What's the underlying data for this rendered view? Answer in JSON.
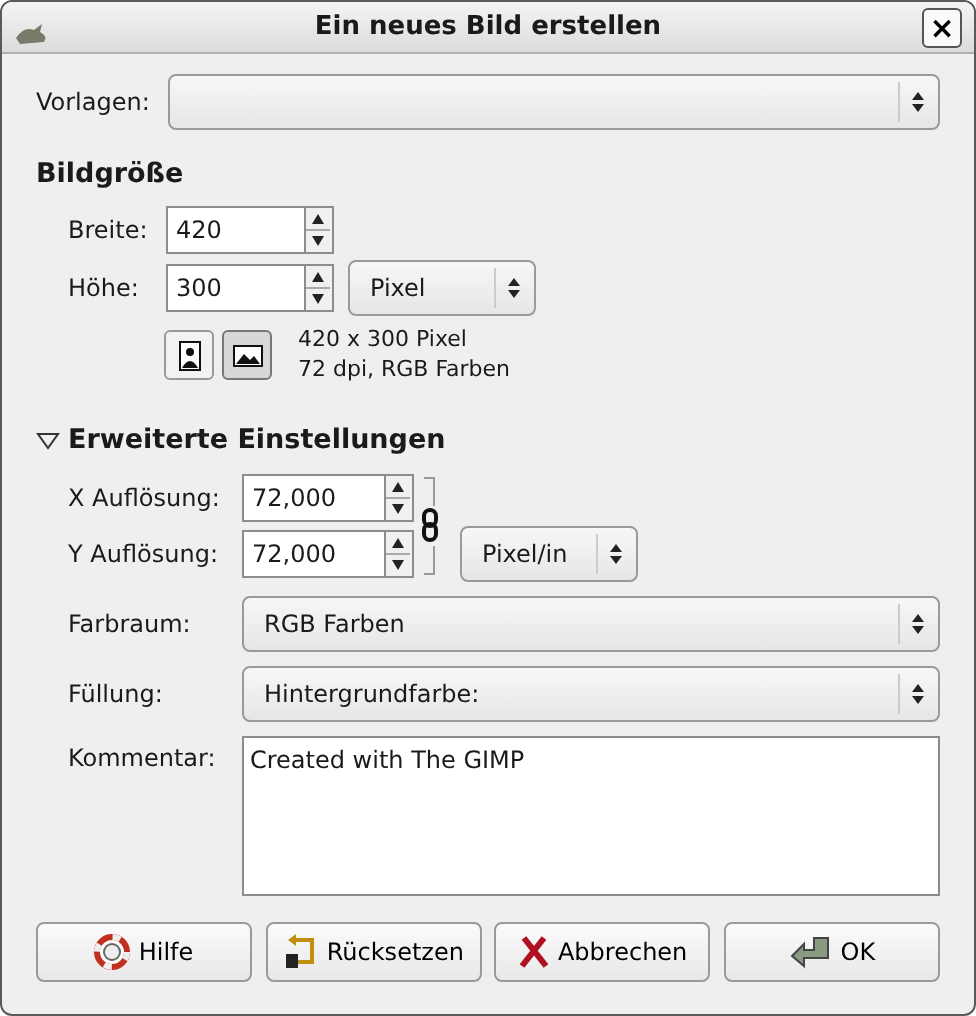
{
  "window": {
    "title": "Ein neues Bild erstellen",
    "close": "×"
  },
  "template": {
    "label": "Vorlagen:"
  },
  "image_size": {
    "heading": "Bildgröße",
    "width": {
      "label": "Breite:",
      "value": "420"
    },
    "height": {
      "label": "Höhe:",
      "value": "300"
    },
    "unit": "Pixel",
    "orientations": [
      {
        "kind": "portrait",
        "selected": false
      },
      {
        "kind": "landscape",
        "selected": true
      }
    ],
    "info": [
      "420 x 300 Pixel",
      "72 dpi, RGB Farben"
    ]
  },
  "advanced": {
    "label": "Erweiterte Einstellungen",
    "expanded": true,
    "x_resolution": {
      "label": "X Auflösung:",
      "value": "72,000"
    },
    "y_resolution": {
      "label": "Y Auflösung:",
      "value": "72,000"
    },
    "chained": true,
    "resolution_unit": "Pixel/in",
    "color_space": {
      "label": "Farbraum:",
      "value": "RGB Farben"
    },
    "fill": {
      "label": "Füllung:",
      "value": "Hintergrundfarbe:"
    },
    "comment": {
      "label": "Kommentar:",
      "value": "Created with The GIMP"
    }
  },
  "buttons": [
    {
      "kind": "help",
      "label": "Hilfe"
    },
    {
      "kind": "reset",
      "label": "Rücksetzen"
    },
    {
      "kind": "cancel",
      "label": "Abbrechen"
    },
    {
      "kind": "ok",
      "label": "OK"
    }
  ]
}
